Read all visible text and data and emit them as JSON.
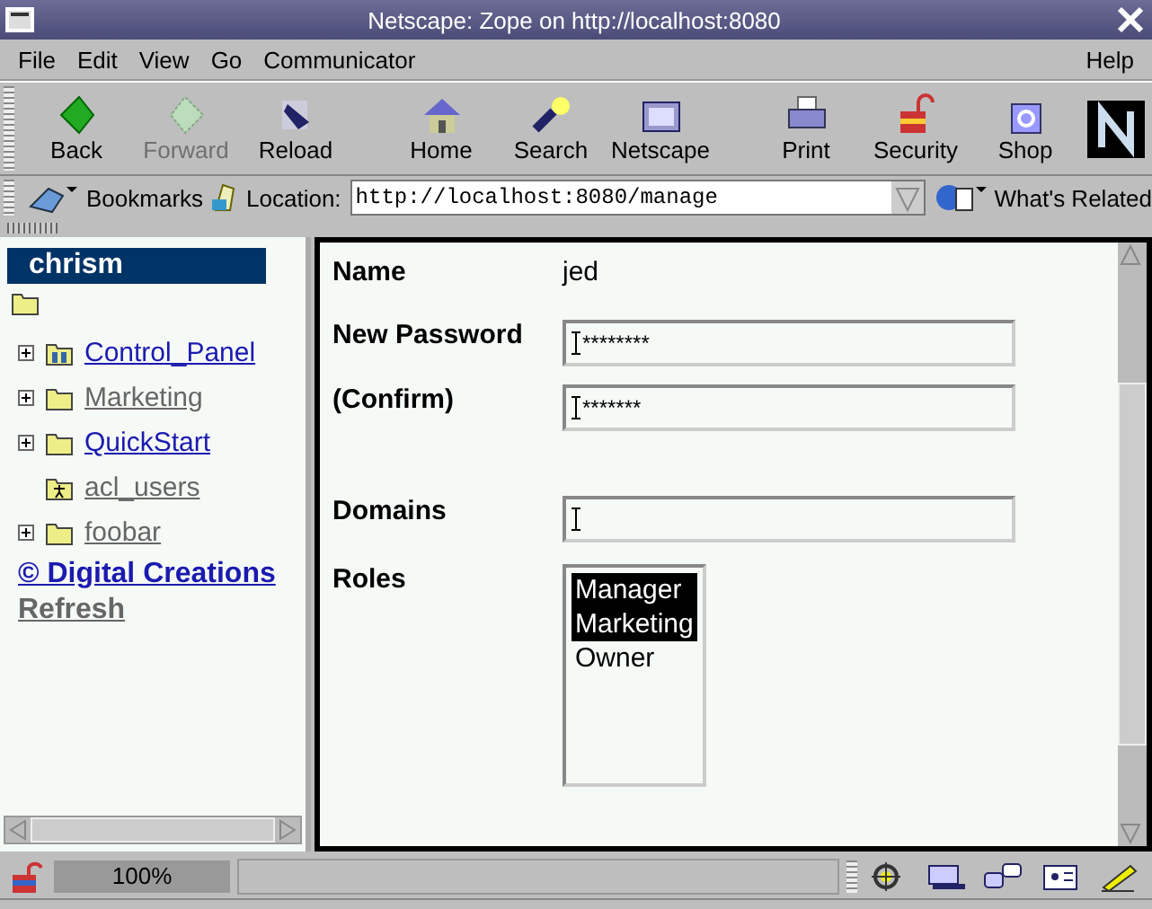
{
  "window": {
    "title": "Netscape: Zope on http://localhost:8080"
  },
  "menu": [
    "File",
    "Edit",
    "View",
    "Go",
    "Communicator"
  ],
  "menu_right": "Help",
  "toolbar": [
    {
      "label": "Back",
      "disabled": false
    },
    {
      "label": "Forward",
      "disabled": true
    },
    {
      "label": "Reload",
      "disabled": false
    },
    {
      "label": "Home",
      "disabled": false
    },
    {
      "label": "Search",
      "disabled": false
    },
    {
      "label": "Netscape",
      "disabled": false
    },
    {
      "label": "Print",
      "disabled": false
    },
    {
      "label": "Security",
      "disabled": false
    },
    {
      "label": "Shop",
      "disabled": false
    }
  ],
  "location": {
    "bookmarks": "Bookmarks",
    "label": "Location:",
    "value": "http://localhost:8080/manage",
    "related": "What's Related"
  },
  "sidebar": {
    "title": "chrism",
    "items": [
      {
        "label": "Control_Panel",
        "kind": "control-panel",
        "expandable": true,
        "visited": false
      },
      {
        "label": "Marketing",
        "kind": "folder",
        "expandable": true,
        "visited": true
      },
      {
        "label": "QuickStart",
        "kind": "folder",
        "expandable": true,
        "visited": false
      },
      {
        "label": "acl_users",
        "kind": "user-folder",
        "expandable": false,
        "visited": true
      },
      {
        "label": "foobar",
        "kind": "folder",
        "expandable": true,
        "visited": true
      }
    ],
    "links": [
      {
        "label": "© Digital Creations",
        "visited": false
      },
      {
        "label": "Refresh",
        "visited": true
      }
    ]
  },
  "form": {
    "name_label": "Name",
    "name_value": "jed",
    "fields": [
      {
        "label": "New Password",
        "value": "********"
      },
      {
        "label": "(Confirm)",
        "value": "*******"
      },
      {
        "label": "Domains"
      }
    ],
    "roles_label": "Roles",
    "roles": [
      {
        "label": "Manager",
        "selected": true
      },
      {
        "label": "Marketing",
        "selected": true
      },
      {
        "label": "Owner",
        "selected": false
      }
    ]
  },
  "status_bar": {
    "zoom": "100%"
  }
}
